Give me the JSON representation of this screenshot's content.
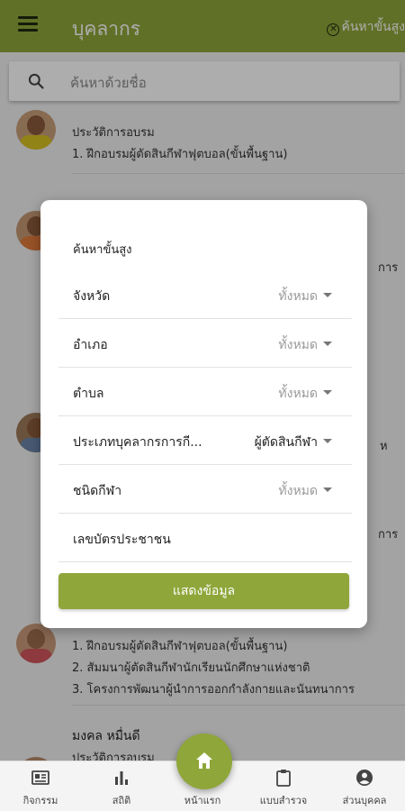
{
  "appbar": {
    "title": "บุคลากร",
    "advanced_search_label": "ค้นหาขั้นสูง",
    "menu_icon": "hamburger-menu-icon",
    "close_icon": "close-circle-icon"
  },
  "search": {
    "placeholder": "ค้นหาด้วยชื่อ",
    "icon": "search-icon"
  },
  "list": {
    "people": [
      {
        "name": "",
        "training_label": "ประวัติการอบรม",
        "trainings": [
          "1. ฝึกอบรมผู้ตัดสินกีฬาฟุตบอล(ขั้นพื้นฐาน)"
        ]
      },
      {
        "name": "",
        "training_label": "",
        "trainings": []
      },
      {
        "name": "",
        "training_label": "",
        "trainings": [
          "1. ฝึกอบรมผู้ตัดสินกีฬาฟุตบอล(ขั้นพื้นฐาน)",
          "2. สัมมนาผู้ตัดสินกีฬานักเรียนนักศึกษาแห่งชาติ",
          "3. โครงการพัฒนาผู้นำการออกกำลังกายและนันทนาการ"
        ]
      },
      {
        "name": "มงคล หมื่นดี",
        "training_label": "ประวัติการอบรม",
        "trainings": []
      }
    ],
    "partial_right_texts": [
      "การ",
      "ห",
      "การ"
    ]
  },
  "dialog": {
    "title": "ค้นหาขั้นสูง",
    "filters": [
      {
        "label": "จังหวัด",
        "value": "ทั้งหมด"
      },
      {
        "label": "อำเภอ",
        "value": "ทั้งหมด"
      },
      {
        "label": "ตำบล",
        "value": "ทั้งหมด"
      },
      {
        "label": "ประเภทบุคลากรการกี...",
        "value": "ผู้ตัดสินกีฬา"
      },
      {
        "label": "ชนิดกีฬา",
        "value": "ทั้งหมด"
      }
    ],
    "id_card_label": "เลขบัตรประชาชน",
    "submit_label": "แสดงข้อมูล"
  },
  "bottom_nav": {
    "items": [
      {
        "label": "กิจกรรม",
        "icon": "news-icon"
      },
      {
        "label": "สถิติ",
        "icon": "bar-chart-icon"
      },
      {
        "label": "หน้าแรก",
        "icon": "home-icon"
      },
      {
        "label": "แบบสำรวจ",
        "icon": "clipboard-icon"
      },
      {
        "label": "ส่วนบุคคล",
        "icon": "account-circle-icon"
      }
    ]
  },
  "colors": {
    "primary": "#8fa63a",
    "overlay": "rgba(0,0,0,0.32)"
  }
}
